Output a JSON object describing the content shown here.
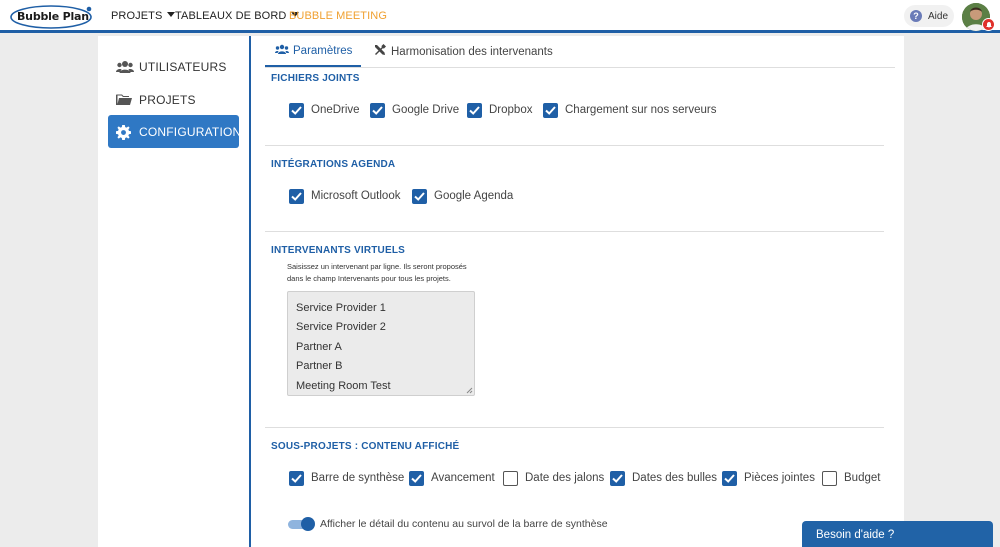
{
  "brand": {
    "logo_text": "Bubble Plan"
  },
  "topnav": {
    "items": [
      {
        "label": "PROJETS"
      },
      {
        "label": "TABLEAUX DE BORD"
      },
      {
        "label": "BUBBLE MEETING"
      }
    ],
    "help_label": "Aide"
  },
  "sidebar": {
    "items": [
      {
        "label": "UTILISATEURS",
        "icon": "users-icon"
      },
      {
        "label": "PROJETS",
        "icon": "folder-icon"
      },
      {
        "label": "CONFIGURATION",
        "icon": "gear-icon",
        "active": true
      }
    ]
  },
  "tabs": [
    {
      "label": "Paramètres",
      "icon": "users-gear-icon",
      "active": true
    },
    {
      "label": "Harmonisation des intervenants",
      "icon": "tools-icon"
    }
  ],
  "sections": {
    "files": {
      "title": "FICHIERS JOINTS",
      "options": [
        {
          "label": "OneDrive",
          "checked": true
        },
        {
          "label": "Google Drive",
          "checked": true
        },
        {
          "label": "Dropbox",
          "checked": true
        },
        {
          "label": "Chargement sur nos serveurs",
          "checked": true
        }
      ]
    },
    "calendar": {
      "title": "INTÉGRATIONS AGENDA",
      "options": [
        {
          "label": "Microsoft Outlook",
          "checked": true
        },
        {
          "label": "Google Agenda",
          "checked": true
        }
      ]
    },
    "virtual": {
      "title": "INTERVENANTS VIRTUELS",
      "help_line1": "Saisissez un intervenant par ligne. Ils seront proposés",
      "help_line2": "dans le champ Intervenants pour tous les projets.",
      "lines": [
        "Service Provider 1",
        "Service Provider 2",
        "Partner A",
        "Partner B",
        "Meeting Room Test"
      ]
    },
    "subprojects": {
      "title": "SOUS-PROJETS : CONTENU AFFICHÉ",
      "options": [
        {
          "label": "Barre de synthèse",
          "checked": true
        },
        {
          "label": "Avancement",
          "checked": true
        },
        {
          "label": "Date des jalons",
          "checked": false
        },
        {
          "label": "Dates des bulles",
          "checked": true
        },
        {
          "label": "Pièces jointes",
          "checked": true
        },
        {
          "label": "Budget",
          "checked": false
        }
      ],
      "toggle_label": "Afficher le détail du contenu au survol de la barre de synthèse",
      "toggle_on": true
    }
  },
  "chat": {
    "label": "Besoin d'aide ?"
  },
  "colors": {
    "primary": "#1f5fa6",
    "accent": "#f0a030",
    "sidebar_active": "#2f78c4"
  }
}
